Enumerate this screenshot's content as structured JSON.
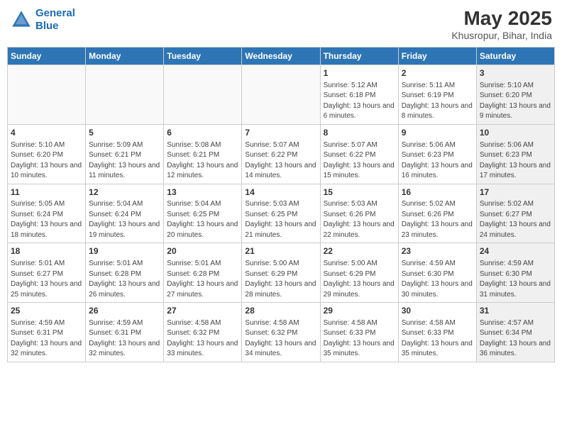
{
  "logo": {
    "line1": "General",
    "line2": "Blue"
  },
  "title": {
    "month_year": "May 2025",
    "location": "Khusropur, Bihar, India"
  },
  "days_of_week": [
    "Sunday",
    "Monday",
    "Tuesday",
    "Wednesday",
    "Thursday",
    "Friday",
    "Saturday"
  ],
  "weeks": [
    [
      {
        "day": "",
        "content": "",
        "shaded": true
      },
      {
        "day": "",
        "content": "",
        "shaded": true
      },
      {
        "day": "",
        "content": "",
        "shaded": true
      },
      {
        "day": "",
        "content": "",
        "shaded": true
      },
      {
        "day": "1",
        "content": "Sunrise: 5:12 AM\nSunset: 6:18 PM\nDaylight: 13 hours and 6 minutes.",
        "shaded": false
      },
      {
        "day": "2",
        "content": "Sunrise: 5:11 AM\nSunset: 6:19 PM\nDaylight: 13 hours and 8 minutes.",
        "shaded": false
      },
      {
        "day": "3",
        "content": "Sunrise: 5:10 AM\nSunset: 6:20 PM\nDaylight: 13 hours and 9 minutes.",
        "shaded": true
      }
    ],
    [
      {
        "day": "4",
        "content": "Sunrise: 5:10 AM\nSunset: 6:20 PM\nDaylight: 13 hours and 10 minutes.",
        "shaded": false
      },
      {
        "day": "5",
        "content": "Sunrise: 5:09 AM\nSunset: 6:21 PM\nDaylight: 13 hours and 11 minutes.",
        "shaded": false
      },
      {
        "day": "6",
        "content": "Sunrise: 5:08 AM\nSunset: 6:21 PM\nDaylight: 13 hours and 12 minutes.",
        "shaded": false
      },
      {
        "day": "7",
        "content": "Sunrise: 5:07 AM\nSunset: 6:22 PM\nDaylight: 13 hours and 14 minutes.",
        "shaded": false
      },
      {
        "day": "8",
        "content": "Sunrise: 5:07 AM\nSunset: 6:22 PM\nDaylight: 13 hours and 15 minutes.",
        "shaded": false
      },
      {
        "day": "9",
        "content": "Sunrise: 5:06 AM\nSunset: 6:23 PM\nDaylight: 13 hours and 16 minutes.",
        "shaded": false
      },
      {
        "day": "10",
        "content": "Sunrise: 5:06 AM\nSunset: 6:23 PM\nDaylight: 13 hours and 17 minutes.",
        "shaded": true
      }
    ],
    [
      {
        "day": "11",
        "content": "Sunrise: 5:05 AM\nSunset: 6:24 PM\nDaylight: 13 hours and 18 minutes.",
        "shaded": false
      },
      {
        "day": "12",
        "content": "Sunrise: 5:04 AM\nSunset: 6:24 PM\nDaylight: 13 hours and 19 minutes.",
        "shaded": false
      },
      {
        "day": "13",
        "content": "Sunrise: 5:04 AM\nSunset: 6:25 PM\nDaylight: 13 hours and 20 minutes.",
        "shaded": false
      },
      {
        "day": "14",
        "content": "Sunrise: 5:03 AM\nSunset: 6:25 PM\nDaylight: 13 hours and 21 minutes.",
        "shaded": false
      },
      {
        "day": "15",
        "content": "Sunrise: 5:03 AM\nSunset: 6:26 PM\nDaylight: 13 hours and 22 minutes.",
        "shaded": false
      },
      {
        "day": "16",
        "content": "Sunrise: 5:02 AM\nSunset: 6:26 PM\nDaylight: 13 hours and 23 minutes.",
        "shaded": false
      },
      {
        "day": "17",
        "content": "Sunrise: 5:02 AM\nSunset: 6:27 PM\nDaylight: 13 hours and 24 minutes.",
        "shaded": true
      }
    ],
    [
      {
        "day": "18",
        "content": "Sunrise: 5:01 AM\nSunset: 6:27 PM\nDaylight: 13 hours and 25 minutes.",
        "shaded": false
      },
      {
        "day": "19",
        "content": "Sunrise: 5:01 AM\nSunset: 6:28 PM\nDaylight: 13 hours and 26 minutes.",
        "shaded": false
      },
      {
        "day": "20",
        "content": "Sunrise: 5:01 AM\nSunset: 6:28 PM\nDaylight: 13 hours and 27 minutes.",
        "shaded": false
      },
      {
        "day": "21",
        "content": "Sunrise: 5:00 AM\nSunset: 6:29 PM\nDaylight: 13 hours and 28 minutes.",
        "shaded": false
      },
      {
        "day": "22",
        "content": "Sunrise: 5:00 AM\nSunset: 6:29 PM\nDaylight: 13 hours and 29 minutes.",
        "shaded": false
      },
      {
        "day": "23",
        "content": "Sunrise: 4:59 AM\nSunset: 6:30 PM\nDaylight: 13 hours and 30 minutes.",
        "shaded": false
      },
      {
        "day": "24",
        "content": "Sunrise: 4:59 AM\nSunset: 6:30 PM\nDaylight: 13 hours and 31 minutes.",
        "shaded": true
      }
    ],
    [
      {
        "day": "25",
        "content": "Sunrise: 4:59 AM\nSunset: 6:31 PM\nDaylight: 13 hours and 32 minutes.",
        "shaded": false
      },
      {
        "day": "26",
        "content": "Sunrise: 4:59 AM\nSunset: 6:31 PM\nDaylight: 13 hours and 32 minutes.",
        "shaded": false
      },
      {
        "day": "27",
        "content": "Sunrise: 4:58 AM\nSunset: 6:32 PM\nDaylight: 13 hours and 33 minutes.",
        "shaded": false
      },
      {
        "day": "28",
        "content": "Sunrise: 4:58 AM\nSunset: 6:32 PM\nDaylight: 13 hours and 34 minutes.",
        "shaded": false
      },
      {
        "day": "29",
        "content": "Sunrise: 4:58 AM\nSunset: 6:33 PM\nDaylight: 13 hours and 35 minutes.",
        "shaded": false
      },
      {
        "day": "30",
        "content": "Sunrise: 4:58 AM\nSunset: 6:33 PM\nDaylight: 13 hours and 35 minutes.",
        "shaded": false
      },
      {
        "day": "31",
        "content": "Sunrise: 4:57 AM\nSunset: 6:34 PM\nDaylight: 13 hours and 36 minutes.",
        "shaded": true
      }
    ]
  ]
}
